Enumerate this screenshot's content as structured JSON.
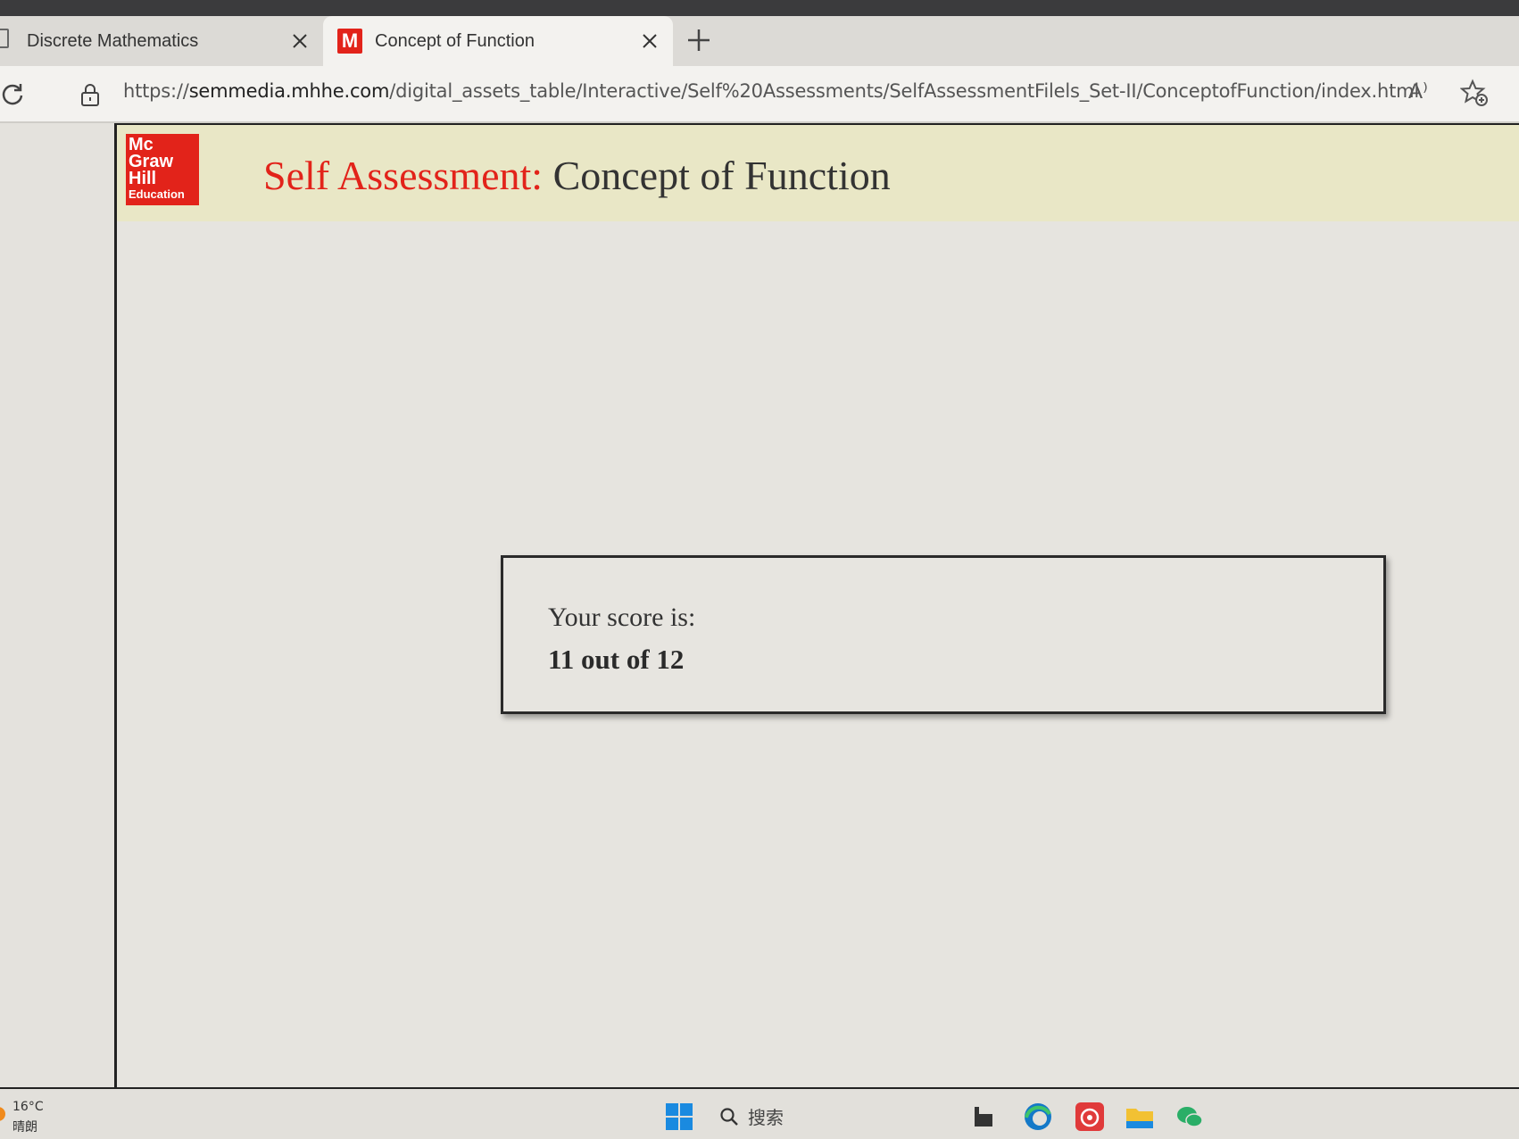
{
  "browser": {
    "tabs": [
      {
        "title": "Discrete Mathematics"
      },
      {
        "title": "Concept of Function",
        "favicon_letter": "M",
        "active": true
      }
    ],
    "address_bar": {
      "url_prefix": "https://",
      "url_domain": "semmedia.mhhe.com",
      "url_path": "/digital_assets_table/Interactive/Self%20Assessments/SelfAssessmentFilels_Set-II/ConceptofFunction/index.html"
    },
    "read_aloud_icon": "A⁾"
  },
  "page": {
    "logo": {
      "line1": "Mc",
      "line2": "Graw",
      "line3": "Hill",
      "line4": "Education",
      "color": "#e2231a"
    },
    "title_prefix": "Self Assessment:",
    "title_main": "Concept of Function",
    "score_label": "Your score is:",
    "score_value": "11 out of 12",
    "header_bg": "#e9e7c6"
  },
  "taskbar": {
    "weather_temp": "16°C",
    "weather_condition": "晴朗",
    "search_placeholder": "搜索",
    "icons": [
      "windows-start-icon",
      "search-icon",
      "task-view-icon",
      "edge-icon",
      "netease-music-icon",
      "file-explorer-icon",
      "wechat-icon"
    ]
  }
}
